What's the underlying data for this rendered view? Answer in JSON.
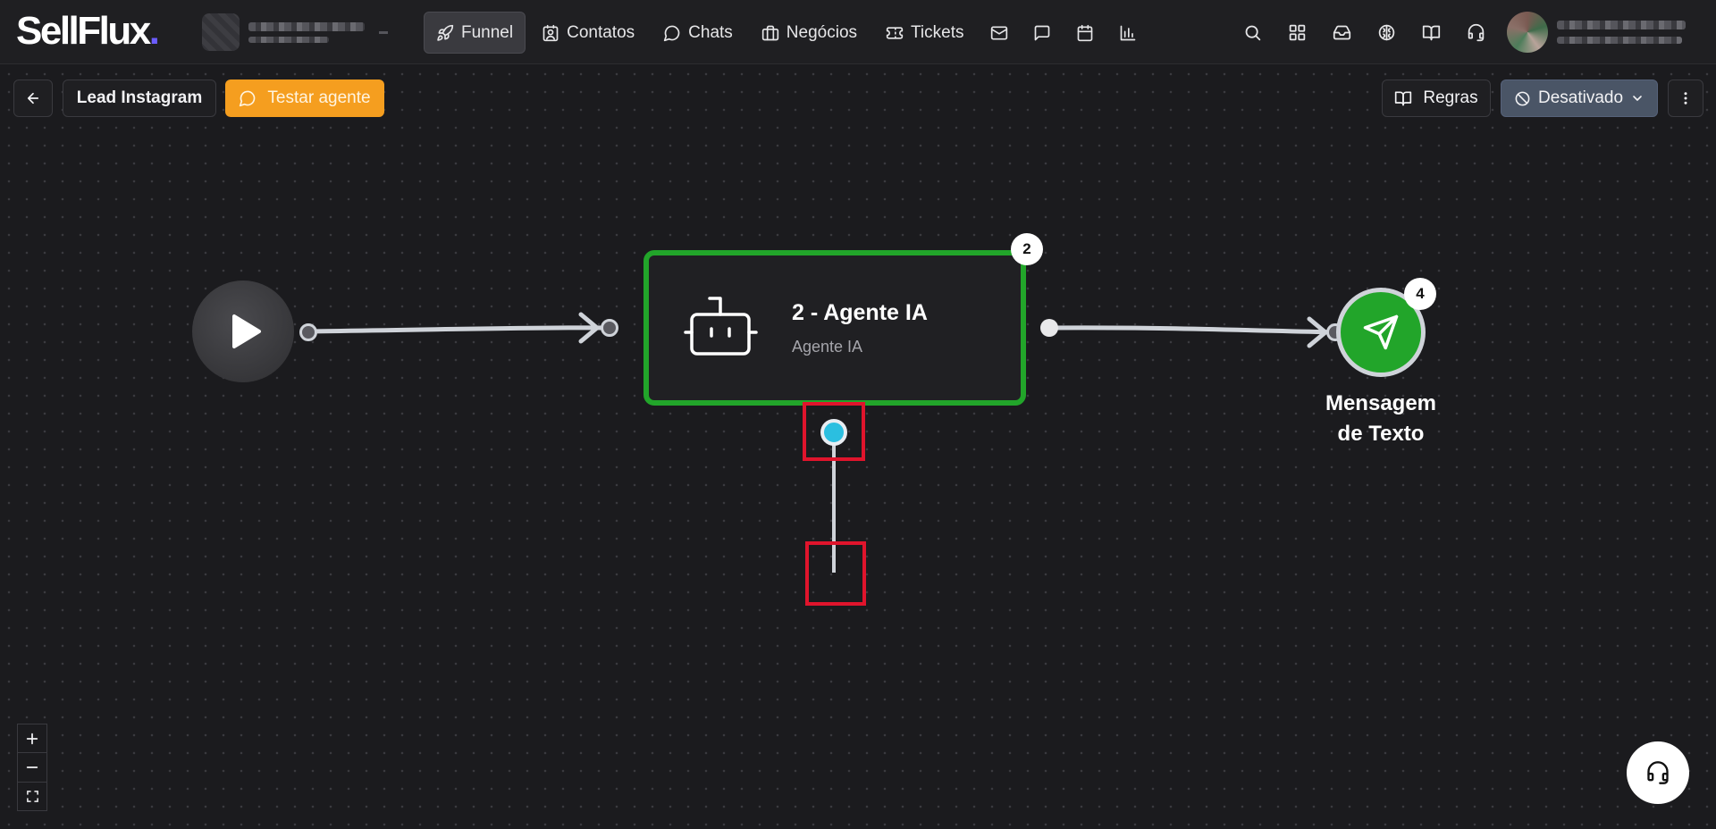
{
  "app": {
    "logo_text": "SellFlux",
    "logo_dot": "."
  },
  "nav": {
    "funnel": "Funnel",
    "contatos": "Contatos",
    "chats": "Chats",
    "negocios": "Negócios",
    "tickets": "Tickets"
  },
  "toolbar": {
    "flow_name": "Lead Instagram",
    "test_agent": "Testar agente",
    "rules": "Regras",
    "status": "Desativado"
  },
  "nodes": {
    "agent": {
      "badge": "2",
      "title": "2 - Agente IA",
      "subtitle": "Agente IA"
    },
    "message": {
      "badge": "4",
      "label_line1": "Mensagem",
      "label_line2": "de Texto"
    }
  },
  "colors": {
    "node_active_border": "#22a52a",
    "test_button": "#f59e1f",
    "status_button": "#4a5566",
    "highlight": "#e0142c",
    "active_handle": "#2bbfe0"
  },
  "icons": {
    "funnel": "rocket-icon",
    "contatos": "contact-card-icon",
    "chats": "chat-bubble-icon",
    "negocios": "briefcase-icon",
    "tickets": "ticket-icon",
    "agent": "robot-icon",
    "message": "send-icon",
    "start": "play-icon"
  }
}
